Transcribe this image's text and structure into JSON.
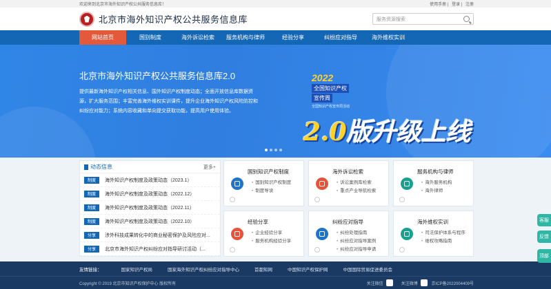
{
  "topbar": {
    "welcome": "欢迎来到北京市海外知识产权公共服务信息库！",
    "links": [
      "使用手册",
      "登录",
      "注册"
    ]
  },
  "header": {
    "site_title": "北京市海外知识产权公共服务信息库",
    "search_placeholder": "服务资源搜索"
  },
  "nav": [
    {
      "label": "网站首页",
      "active": true
    },
    {
      "label": "国别制度"
    },
    {
      "label": "海外诉讼检索"
    },
    {
      "label": "服务机构与律师"
    },
    {
      "label": "经验分享"
    },
    {
      "label": "纠纷应对指导"
    },
    {
      "label": "海外维权实训"
    }
  ],
  "banner": {
    "title": "北京市海外知识产权公共服务信息库2.0",
    "desc": "提供最新海外知识产权相关信息、国外知识产权制度动态；全面开放信息库数据资源，扩大服务范围；丰富完善海外维权实训课件，提升企业海外知识产权风险防控和纠纷应对能力；系统内容收藏和单向提交获取功能，提高用户使用体验。",
    "badge_year": "2022",
    "badge_line1": "全国知识产权",
    "badge_line2": "宣传周",
    "badge_small": "全国知识产权宣传周活动",
    "big_text_a": "2.0",
    "big_text_b": "版升级上线"
  },
  "news": {
    "title": "动态信息",
    "more": "更多+",
    "items": [
      {
        "tag": "制度",
        "text": "海外知识产权制度及政策动态（2023.1）"
      },
      {
        "tag": "制度",
        "text": "海外知识产权制度及政策动态（2022.12）"
      },
      {
        "tag": "制度",
        "text": "海外知识产权制度及政策动态（2022.11）"
      },
      {
        "tag": "制度",
        "text": "海外知识产权制度及政策动态（2022.10）"
      },
      {
        "tag": "分享",
        "text": "涉外科技成果转化中的商业秘密保护及风险应对..."
      },
      {
        "tag": "分享",
        "text": "北京市海外知识产权纠纷应对指导研讨活动（..."
      }
    ]
  },
  "cards": [
    {
      "title": "国别知识产权制度",
      "lines": [
        "国别知识产权制度",
        "制度导读"
      ],
      "color": "#1f73c9"
    },
    {
      "title": "海外诉讼检索",
      "lines": [
        "诉讼案例库检索",
        "重点产业导航检索"
      ],
      "color": "#e5533b"
    },
    {
      "title": "服务机构与律师",
      "lines": [
        "海外服务机构",
        "海外律师"
      ],
      "color": "#19a08e"
    },
    {
      "title": "经验分享",
      "lines": [
        "企业经验分享",
        "服务机构经验分享"
      ],
      "color": "#e5533b"
    },
    {
      "title": "纠纷应对指导",
      "lines": [
        "纠纷处理指南",
        "纠纷应对指导案例",
        "纠纷应对指导申请"
      ],
      "color": "#1f73c9"
    },
    {
      "title": "海外维权实训",
      "lines": [
        "司法保护体系与程序",
        "维权攻略指南"
      ],
      "color": "#19a08e"
    }
  ],
  "footer": {
    "friend_label": "友情链接：",
    "friend_links": [
      "国家知识产权局",
      "国家海外知识产权纠纷应对指导中心",
      "首都知网",
      "中国知识产权保护网",
      "中国国际贸易促进委员会"
    ],
    "copyright": "Copyright © 2019 北京市知识产权保护中心 版权所有",
    "follow_wechat": "关注微信",
    "follow_weibo": "关注微博",
    "icp": "京ICP备2022004409号"
  },
  "side": [
    "客服",
    "反馈",
    "顶部"
  ]
}
